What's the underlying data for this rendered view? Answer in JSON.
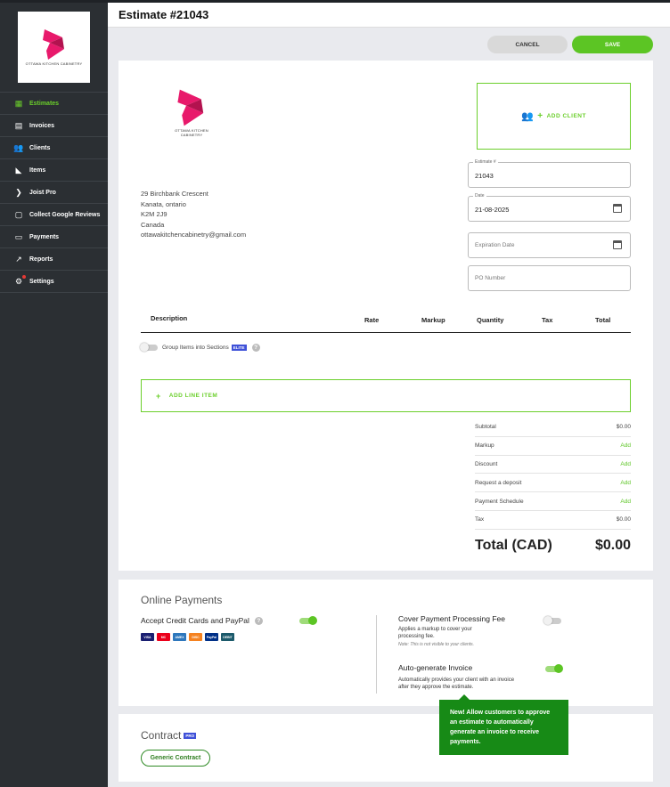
{
  "sidebar": {
    "logo_text": "OTTAWA KITCHEN CABINETRY",
    "items": [
      {
        "label": "Estimates",
        "icon": "estimate-icon",
        "active": true
      },
      {
        "label": "Invoices",
        "icon": "invoice-icon"
      },
      {
        "label": "Clients",
        "icon": "clients-icon"
      },
      {
        "label": "Items",
        "icon": "items-icon"
      },
      {
        "label": "Joist Pro",
        "icon": "joist-pro-icon"
      },
      {
        "label": "Collect Google Reviews",
        "icon": "reviews-icon"
      },
      {
        "label": "Payments",
        "icon": "payments-icon"
      },
      {
        "label": "Reports",
        "icon": "reports-icon"
      },
      {
        "label": "Settings",
        "icon": "settings-icon",
        "notification": true
      }
    ]
  },
  "header": {
    "title": "Estimate #21043"
  },
  "actions": {
    "cancel": "CANCEL",
    "save": "SAVE"
  },
  "document": {
    "logo_text": "OTTAWA KITCHEN CABINETRY",
    "address": [
      "29 Birchbank Crescent",
      "Kanata, ontario",
      "K2M 2J9",
      "Canada",
      "ottawakitchencabinetry@gmail.com"
    ],
    "add_client": "ADD CLIENT",
    "fields": {
      "estimate_no": {
        "label": "Estimate #",
        "value": "21043"
      },
      "date": {
        "label": "Date",
        "value": "21-08-2025"
      },
      "expiration": {
        "placeholder": "Expiration Date"
      },
      "po": {
        "placeholder": "PO Number"
      }
    },
    "columns": [
      "Description",
      "Rate",
      "Markup",
      "Quantity",
      "Tax",
      "Total"
    ],
    "group_label": "Group Items into Sections",
    "elite_badge": "ELITE",
    "add_line_item": "ADD LINE ITEM",
    "totals": [
      {
        "label": "Subtotal",
        "value": "$0.00"
      },
      {
        "label": "Markup",
        "value": "Add",
        "link": true
      },
      {
        "label": "Discount",
        "value": "Add",
        "link": true
      },
      {
        "label": "Request a deposit",
        "value": "Add",
        "link": true
      },
      {
        "label": "Payment Schedule",
        "value": "Add",
        "link": true
      },
      {
        "label": "Tax",
        "value": "$0.00"
      }
    ],
    "grand_total_label": "Total (CAD)",
    "grand_total_value": "$0.00"
  },
  "payments": {
    "title": "Online Payments",
    "accept_label": "Accept Credit Cards and PayPal",
    "accept_on": true,
    "cards": [
      {
        "label": "VISA",
        "color": "#1a1f71"
      },
      {
        "label": "MC",
        "color": "#eb001b"
      },
      {
        "label": "AMEX",
        "color": "#2e77bc"
      },
      {
        "label": "DISC",
        "color": "#f58220"
      },
      {
        "label": "PayPal",
        "color": "#003087"
      },
      {
        "label": "DEBIT",
        "color": "#1c5a6b"
      }
    ],
    "cover_fee_title": "Cover Payment Processing Fee",
    "cover_fee_desc": "Applies a markup to cover your processing fee.",
    "cover_fee_note": "Note: This is not visible to your clients.",
    "cover_fee_on": false,
    "auto_invoice_title": "Auto-generate Invoice",
    "auto_invoice_desc": "Automatically provides your client with an invoice after they approve the estimate.",
    "auto_invoice_on": true,
    "tooltip": "New! Allow customers to approve an estimate to automatically generate an invoice to receive payments."
  },
  "contract": {
    "title": "Contract",
    "pro_badge": "PRO",
    "button": "Generic Contract"
  },
  "colors": {
    "accent": "#5cc524",
    "sidebar": "#2b2f33",
    "brand_pink": "#e8196b"
  }
}
